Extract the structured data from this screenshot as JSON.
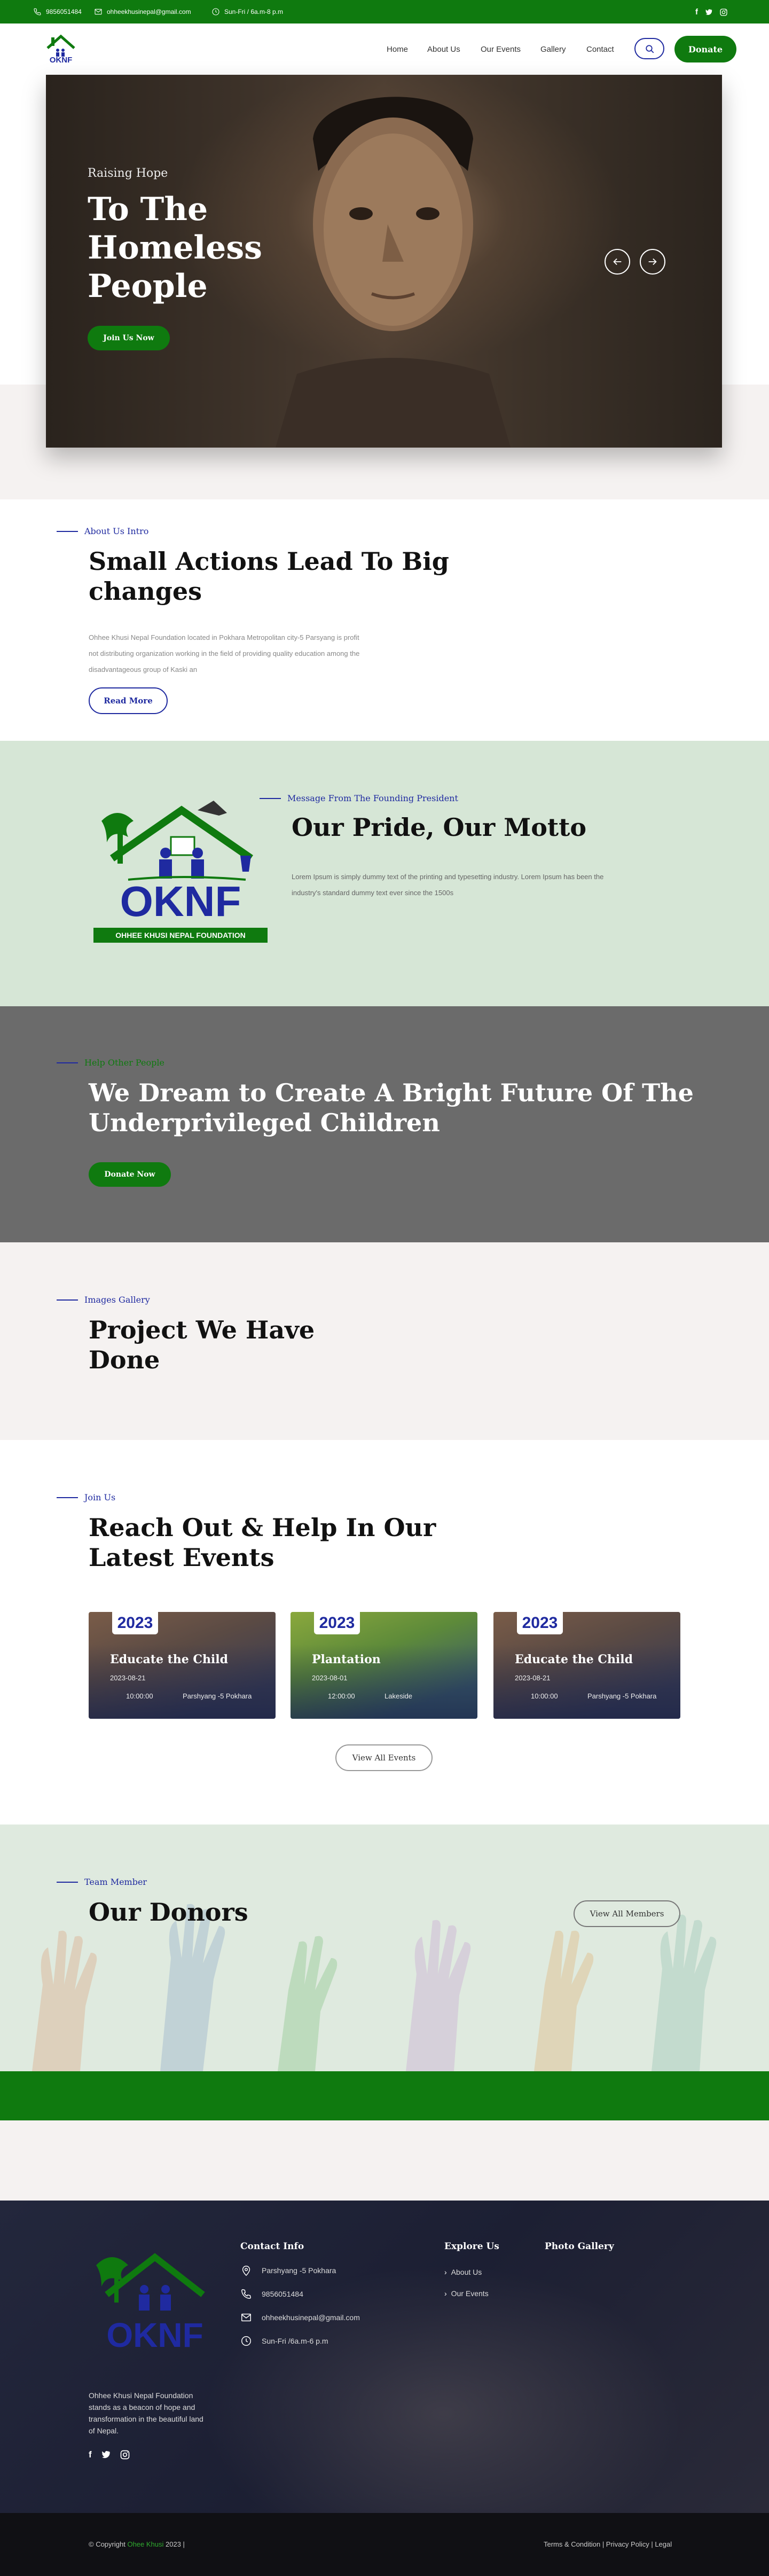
{
  "topbar": {
    "phone": "9856051484",
    "email": "ohheekhusinepal@gmail.com",
    "hours": "Sun-Fri / 6a.m-8 p.m"
  },
  "brand": {
    "logo_text": "OKNF",
    "logo_sub": "OHHEE KHUSI NEPAL FOUNDATION"
  },
  "nav": {
    "items": [
      "Home",
      "About Us",
      "Our Events",
      "Gallery",
      "Contact"
    ],
    "donate": "Donate"
  },
  "hero": {
    "eyebrow": "Raising Hope",
    "title_line1": "To The",
    "title_line2": "Homeless",
    "title_line3": "People",
    "cta": "Join Us Now"
  },
  "about": {
    "eyebrow": "About Us Intro",
    "title_line1": "Small Actions Lead To Big",
    "title_line2": "changes",
    "body_line1": "Ohhee Khusi Nepal Foundation located in Pokhara Metropolitan city-5 Parsyang is profit",
    "body_line2": "not distributing organization working in the field of providing quality education among the",
    "body_line3": "disadvantageous group of Kaski an",
    "cta": "Read More"
  },
  "message": {
    "eyebrow": "Message From The Founding President",
    "title": "Our Pride, Our Motto",
    "body_line1": "Lorem Ipsum is simply dummy text of the printing and typesetting industry. Lorem Ipsum has been the",
    "body_line2": "industry's standard dummy text ever since the 1500s"
  },
  "help": {
    "eyebrow": "Help Other People",
    "title_line1": "We Dream to Create A Bright Future Of The",
    "title_line2": "Underprivileged Children",
    "cta": "Donate Now"
  },
  "gallery": {
    "eyebrow": "Images Gallery",
    "title_line1": "Project We Have",
    "title_line2": "Done"
  },
  "events": {
    "eyebrow": "Join Us",
    "title_line1": "Reach Out & Help In Our",
    "title_line2": "Latest Events",
    "cards": [
      {
        "year": "2023",
        "title": "Educate the Child",
        "date": "2023-08-21",
        "time": "10:00:00",
        "place": "Parshyang -5 Pokhara"
      },
      {
        "year": "2023",
        "title": "Plantation",
        "date": "2023-08-01",
        "time": "12:00:00",
        "place": "Lakeside"
      },
      {
        "year": "2023",
        "title": "Educate the Child",
        "date": "2023-08-21",
        "time": "10:00:00",
        "place": "Parshyang -5 Pokhara"
      }
    ],
    "view_all": "View All Events"
  },
  "donors": {
    "eyebrow": "Team Member",
    "title": "Our Donors",
    "view_all": "View All Members"
  },
  "footer": {
    "about_line1": "Ohhee Khusi Nepal Foundation",
    "about_line2": "stands as a beacon of hope and",
    "about_line3": "transformation in the beautiful land",
    "about_line4": "of Nepal.",
    "contact_heading": "Contact Info",
    "contact_address": "Parshyang -5 Pokhara",
    "contact_phone": "9856051484",
    "contact_email": "ohheekhusinepal@gmail.com",
    "contact_hours": "Sun-Fri /6a.m-6 p.m",
    "explore_heading": "Explore Us",
    "explore_items": [
      "About Us",
      "Our Events"
    ],
    "photo_heading": "Photo Gallery",
    "copyright_prefix": "© Copyright",
    "copyright_brand": "Ohee Khusi",
    "copyright_suffix": "2023 |",
    "legal": "Terms & Condition | Privacy Policy | Legal"
  },
  "colors": {
    "green": "#0f7a0f",
    "blue": "#1f2aa0",
    "light_green": "#d6e6d6",
    "gray": "#6b6b6b",
    "cream": "#f5f2f1",
    "footer": "#1c1f33"
  }
}
